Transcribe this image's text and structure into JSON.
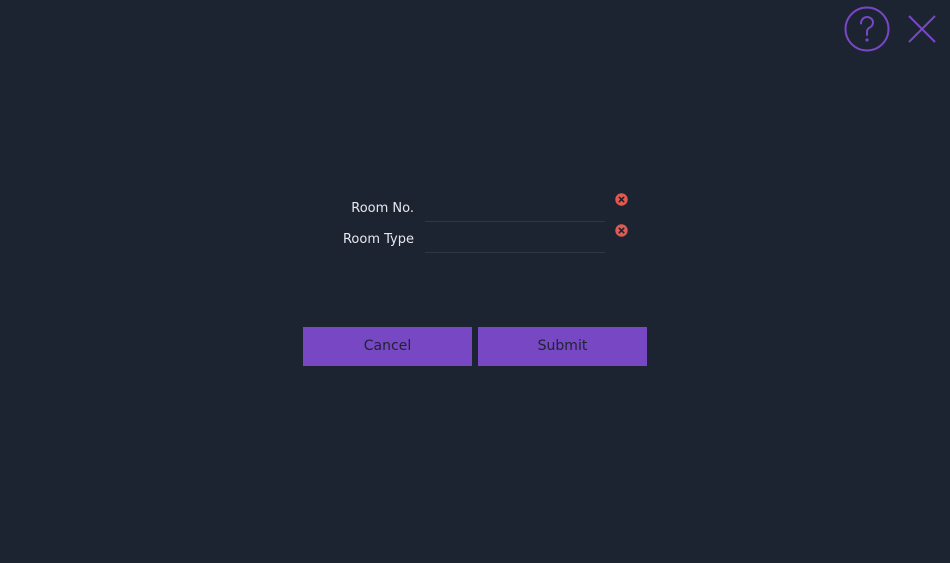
{
  "header": {
    "help_icon": "question-circle-icon",
    "close_icon": "close-icon",
    "accent_color": "#7747c4"
  },
  "form": {
    "fields": [
      {
        "label": "Room No.",
        "value": "",
        "error_icon": "error-icon",
        "error_color": "#e05a4f"
      },
      {
        "label": "Room Type",
        "value": "",
        "error_icon": "error-icon",
        "error_color": "#e05a4f"
      }
    ]
  },
  "actions": {
    "cancel_label": "Cancel",
    "submit_label": "Submit"
  }
}
